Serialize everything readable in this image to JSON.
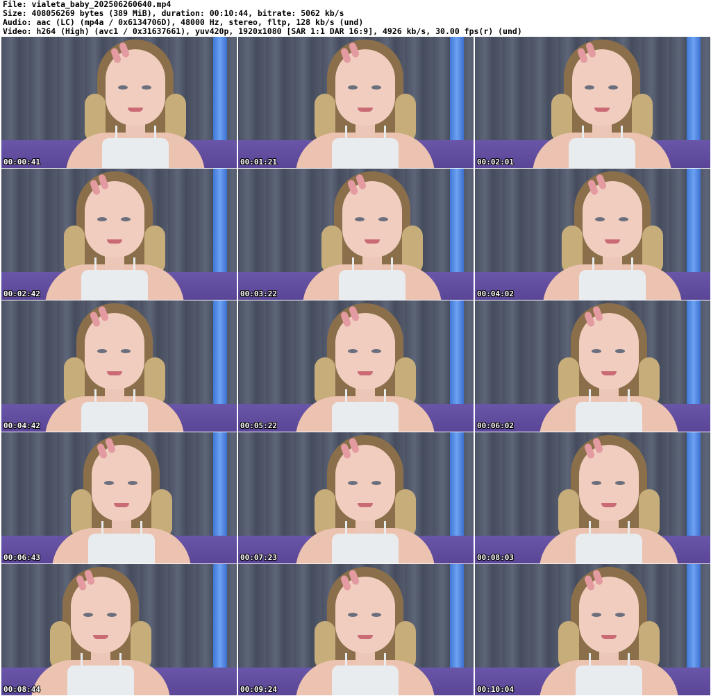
{
  "header": {
    "file": "File: vialeta_baby_202506260640.mp4",
    "size": "Size: 408056269 bytes (389 MiB), duration: 00:10:44, bitrate: 5062 kb/s",
    "audio": "Audio: aac (LC) (mp4a / 0x6134706D), 48000 Hz, stereo, fltp, 128 kb/s (und)",
    "video": "Video: h264 (High) (avc1 / 0x31637661), yuv420p, 1920x1080 [SAR 1:1 DAR 16:9], 4926 kb/s, 30.00 fps(r) (und)"
  },
  "thumbnails": [
    {
      "time": "00:00:41"
    },
    {
      "time": "00:01:21"
    },
    {
      "time": "00:02:01"
    },
    {
      "time": "00:02:42"
    },
    {
      "time": "00:03:22"
    },
    {
      "time": "00:04:02"
    },
    {
      "time": "00:04:42"
    },
    {
      "time": "00:05:22"
    },
    {
      "time": "00:06:02"
    },
    {
      "time": "00:06:43"
    },
    {
      "time": "00:07:23"
    },
    {
      "time": "00:08:03"
    },
    {
      "time": "00:08:44"
    },
    {
      "time": "00:09:24"
    },
    {
      "time": "00:10:04"
    }
  ],
  "colors": {
    "curtain": "#535a6c",
    "blue_strip": "#5a8ee6",
    "blanket": "#5f4a9c",
    "timestamp_text": "#ffffff"
  }
}
